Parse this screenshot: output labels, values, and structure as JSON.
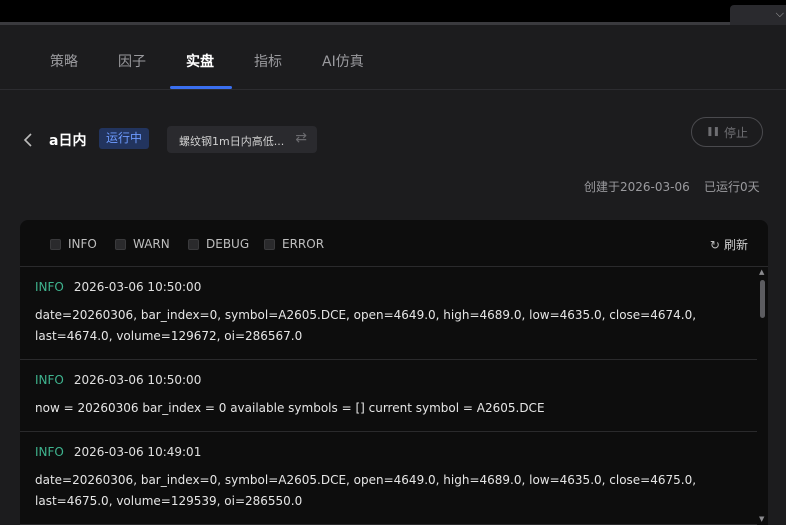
{
  "tabs": [
    {
      "label": "策略"
    },
    {
      "label": "因子"
    },
    {
      "label": "实盘"
    },
    {
      "label": "指标"
    },
    {
      "label": "AI仿真"
    }
  ],
  "header": {
    "strategy_name": "a日内",
    "status": "运行中",
    "product": "螺纹钢1m日内高低...",
    "stop_label": "停止",
    "created": "创建于2026-03-06",
    "running": "已运行0天"
  },
  "filters": [
    {
      "label": "INFO"
    },
    {
      "label": "WARN"
    },
    {
      "label": "DEBUG"
    },
    {
      "label": "ERROR"
    }
  ],
  "refresh_label": "刷新",
  "logs": [
    {
      "level": "INFO",
      "time": "2026-03-06 10:50:00",
      "message": "date=20260306, bar_index=0, symbol=A2605.DCE, open=4649.0, high=4689.0, low=4635.0, close=4674.0, last=4674.0, volume=129672, oi=286567.0"
    },
    {
      "level": "INFO",
      "time": "2026-03-06 10:50:00",
      "message": "now = 20260306 bar_index = 0 available symbols = [] current symbol = A2605.DCE"
    },
    {
      "level": "INFO",
      "time": "2026-03-06 10:49:01",
      "message": "date=20260306, bar_index=0, symbol=A2605.DCE, open=4649.0, high=4689.0, low=4635.0, close=4675.0, last=4675.0, volume=129539, oi=286550.0"
    }
  ],
  "colors": {
    "accent": "#3a6ff0",
    "info": "#3fb48f",
    "badge_text": "#6d9bff"
  }
}
